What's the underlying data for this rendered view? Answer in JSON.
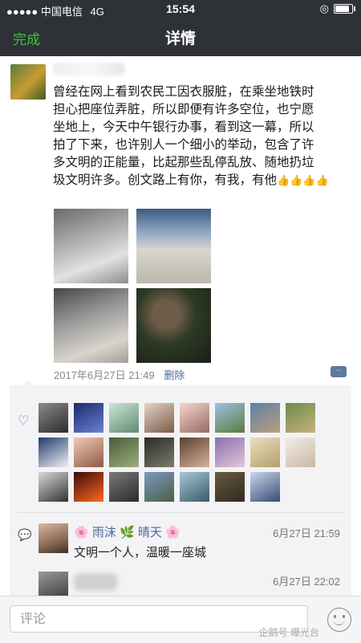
{
  "status_bar": {
    "signal": "●●●●●",
    "carrier": "中国电信",
    "network": "4G",
    "time": "15:54",
    "battery_level": 0.85
  },
  "navbar": {
    "done_label": "完成",
    "title": "详情"
  },
  "post": {
    "text_lines": [
      "曾经在网上看到农民工因衣服脏，在乘坐地铁时",
      "担心把座位弄脏，所以即便有许多空位，也宁愿",
      "坐地上，今天中午银行办事，看到这一幕，所以",
      "拍了下来，也许别人一个细小的举动，包含了许",
      "多文明的正能量，比起那些乱停乱放、随地扔垃",
      "圾文明许多。创文路上有你，有我，有他"
    ],
    "thumbs": "👍👍👍👍",
    "timestamp": "2017年6月27日 21:49",
    "delete_label": "删除",
    "comment_icon": "··"
  },
  "likes": {
    "heart_icon": "♡",
    "avatar_colors": [
      [
        "#8b8b8b",
        "#2c2c2c"
      ],
      [
        "#1b2a6b",
        "#6d7fd6"
      ],
      [
        "#cfe3d8",
        "#5f8c72"
      ],
      [
        "#e6d4c8",
        "#7c5a46"
      ],
      [
        "#f1d6cf",
        "#9a6b60"
      ],
      [
        "#9dc3e8",
        "#5a7a3a"
      ],
      [
        "#5f7fa8",
        "#b8a07a"
      ],
      [
        "#6e8a4a",
        "#c6b27c"
      ],
      [
        "#203a70",
        "#f0f0f0"
      ],
      [
        "#f2c9b5",
        "#8c5a48"
      ],
      [
        "#4a5a3a",
        "#9cb07a"
      ],
      [
        "#2a2a2a",
        "#7c7c6a"
      ],
      [
        "#5a3f30",
        "#d9b39a"
      ],
      [
        "#8a6fb0",
        "#e2c7d8"
      ],
      [
        "#e9dfbf",
        "#b4a06a"
      ],
      [
        "#f2ede6",
        "#c9b8a3"
      ],
      [
        "#d8d8d8",
        "#333333"
      ],
      [
        "#3a0a0a",
        "#ff6a1f"
      ],
      [
        "#7a7a7a",
        "#2a2a2a"
      ],
      [
        "#7a9abf",
        "#4b5f46"
      ],
      [
        "#a4c8d8",
        "#3c5a66"
      ],
      [
        "#6b5a3f",
        "#2e2a22"
      ],
      [
        "#c8d8ea",
        "#3a4a7a"
      ]
    ]
  },
  "comments": [
    {
      "name_prefix": "🌸",
      "name_a": "雨沫",
      "leaf": "🌿",
      "name_b": "晴天",
      "name_suffix": "🌸",
      "time": "6月27日 21:59",
      "text": "文明一个人，温暖一座城"
    },
    {
      "time": "6月27日 22:02"
    }
  ],
  "input": {
    "placeholder": "评论",
    "watermark": "企鹅号 曝光台"
  }
}
